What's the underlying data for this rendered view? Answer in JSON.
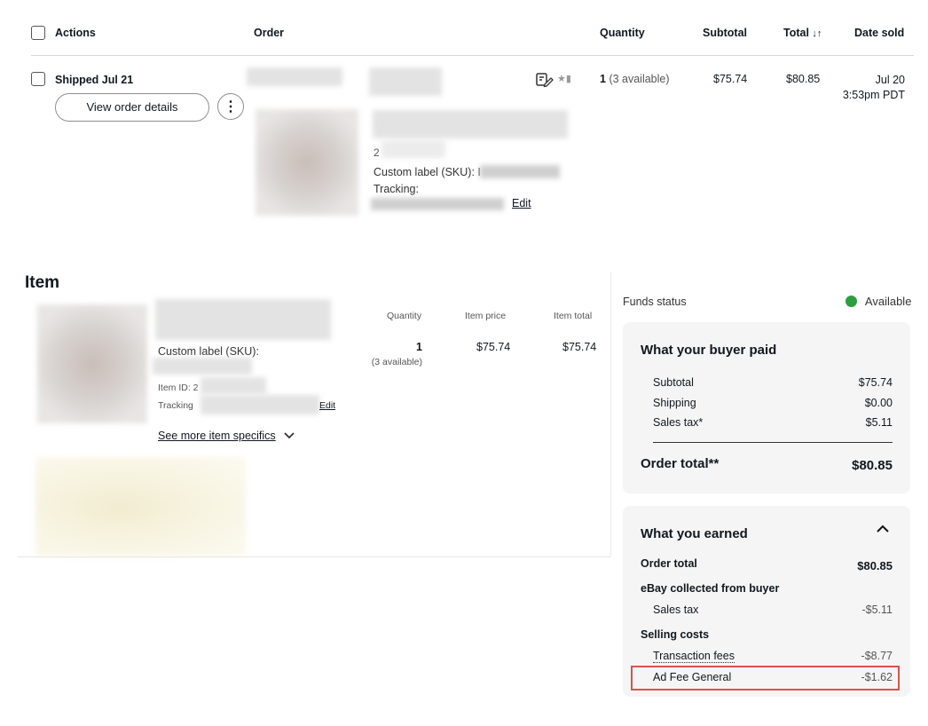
{
  "table": {
    "headers": {
      "actions": "Actions",
      "order": "Order",
      "quantity": "Quantity",
      "subtotal": "Subtotal",
      "total": "Total",
      "total_sort_glyph": "↓↑",
      "date_sold": "Date sold"
    },
    "row": {
      "status": "Shipped Jul 21",
      "view_order_details": "View order details",
      "more_glyph": "⋮",
      "sku_prefix": "2",
      "custom_label": "Custom label (SKU): I",
      "tracking_label": "Tracking:",
      "edit": "Edit",
      "quantity_main": "1",
      "quantity_available": "(3 available)",
      "subtotal": "$75.74",
      "total": "$80.85",
      "date_line1": "Jul 20",
      "date_line2": "3:53pm PDT"
    }
  },
  "item_section": {
    "title": "Item",
    "col_quantity": "Quantity",
    "col_item_price": "Item price",
    "col_item_total": "Item total",
    "custom_label": "Custom label (SKU):",
    "item_id": "Item ID: 2",
    "tracking": "Tracking",
    "edit": "Edit",
    "see_more": "See more item specifics",
    "quantity": "1",
    "quantity_available": "(3 available)",
    "item_price": "$75.74",
    "item_total": "$75.74"
  },
  "funds": {
    "label": "Funds status",
    "status": "Available",
    "status_color": "#2e9e3f"
  },
  "buyer_paid": {
    "title": "What your buyer paid",
    "rows": [
      {
        "label": "Subtotal",
        "value": "$75.74"
      },
      {
        "label": "Shipping",
        "value": "$0.00"
      },
      {
        "label": "Sales tax*",
        "value": "$5.11"
      }
    ],
    "order_total_label": "Order total**",
    "order_total_value": "$80.85"
  },
  "earned": {
    "title": "What you earned",
    "collapse_glyph": "^",
    "order_total_label": "Order total",
    "order_total_value": "$80.85",
    "ebay_collected_label": "eBay collected from buyer",
    "sales_tax_label": "Sales tax",
    "sales_tax_value": "-$5.11",
    "selling_costs_label": "Selling costs",
    "transaction_fees_label": "Transaction fees",
    "transaction_fees_value": "-$8.77",
    "ad_fee_label": "Ad Fee General",
    "ad_fee_value": "-$1.62",
    "highlight_color": "#d9534f"
  }
}
